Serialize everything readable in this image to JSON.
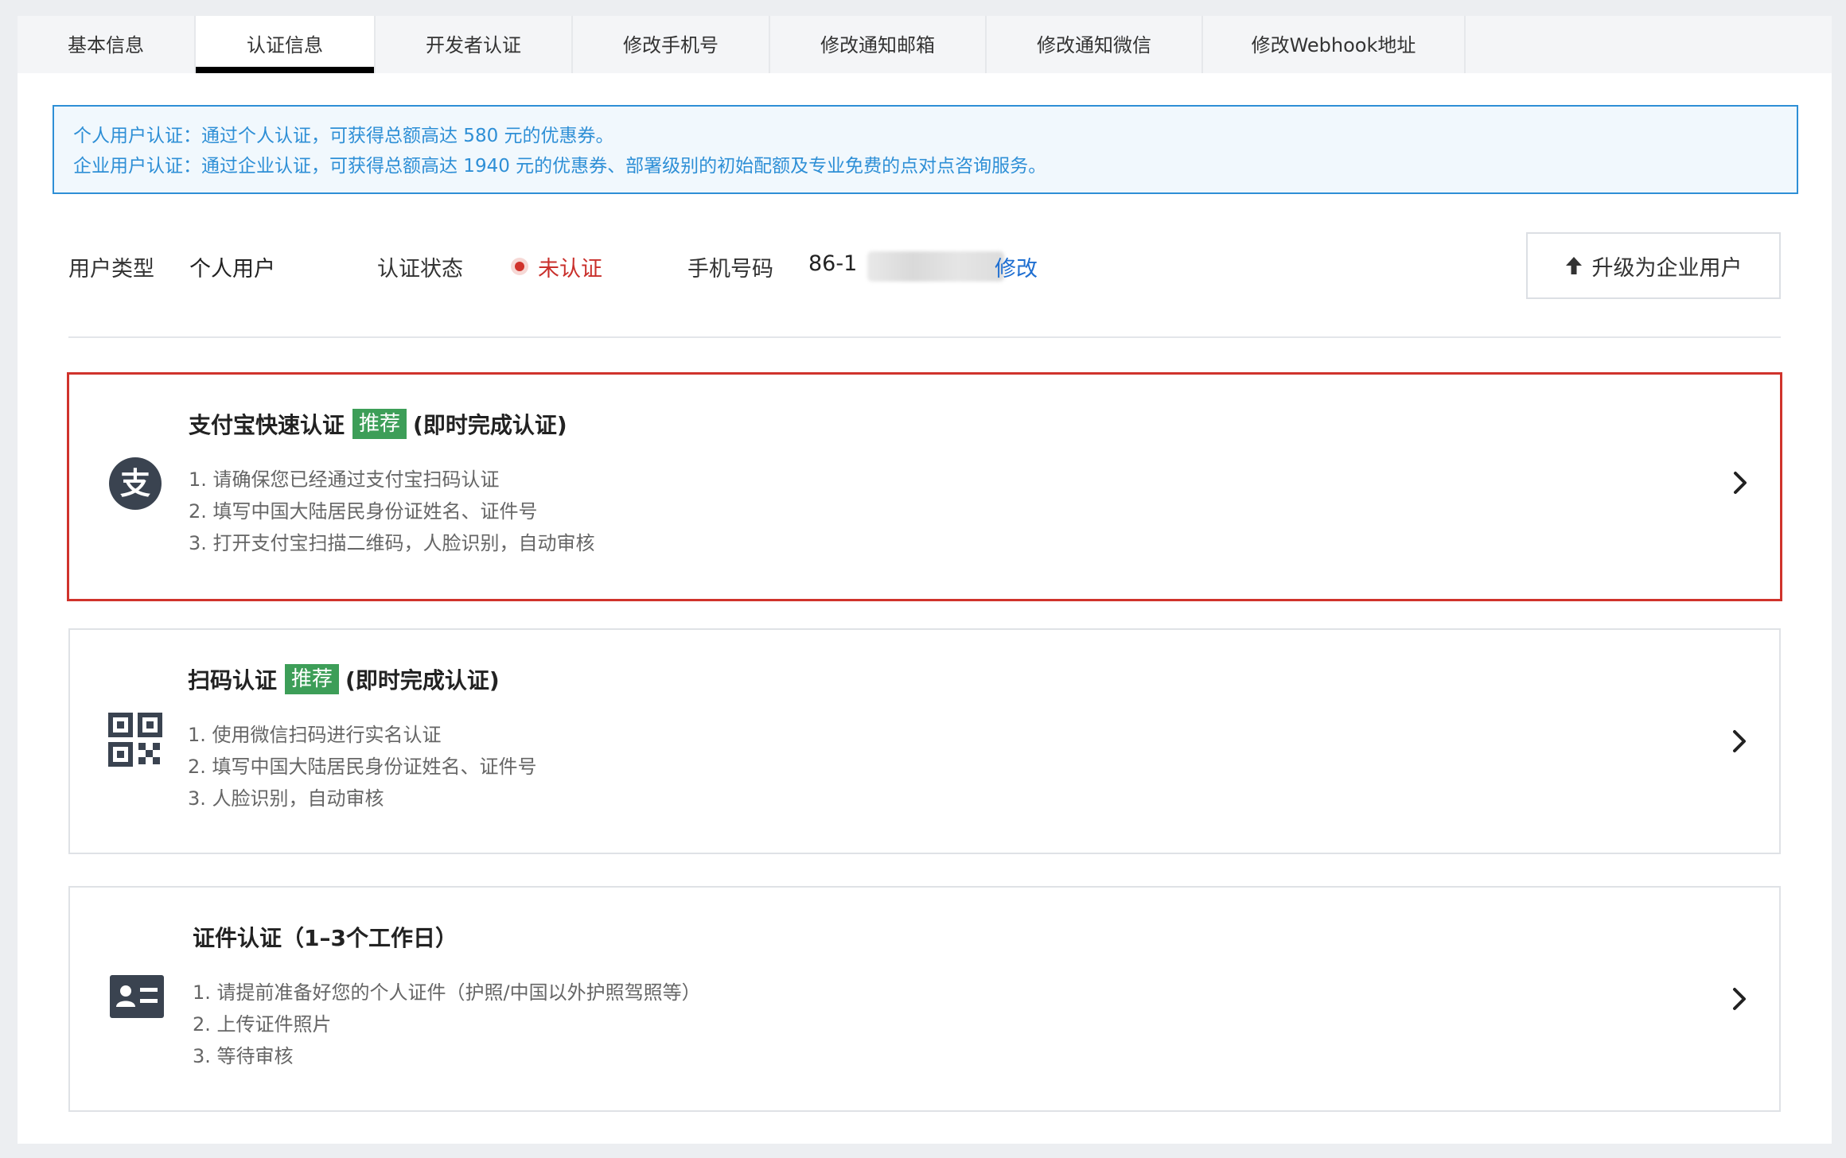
{
  "tabs": [
    {
      "label": "基本信息"
    },
    {
      "label": "认证信息"
    },
    {
      "label": "开发者认证"
    },
    {
      "label": "修改手机号"
    },
    {
      "label": "修改通知邮箱"
    },
    {
      "label": "修改通知微信"
    },
    {
      "label": "修改Webhook地址"
    }
  ],
  "active_tab": "认证信息",
  "banner": {
    "line1": "个人用户认证：通过个人认证，可获得总额高达 580 元的优惠券。",
    "line2": "企业用户认证：通过企业认证，可获得总额高达 1940 元的优惠券、部署级别的初始配额及专业免费的点对点咨询服务。"
  },
  "user_info": {
    "type_label": "用户类型",
    "type_value": "个人用户",
    "status_label": "认证状态",
    "status_value": "未认证",
    "phone_label": "手机号码",
    "phone_value": "86-1",
    "edit_link": "修改",
    "upgrade_button": "升级为企业用户"
  },
  "colors": {
    "accent_blue": "#2e8fd6",
    "link_blue": "#1f6fd1",
    "status_red": "#c9302c",
    "badge_green": "#3d9e58"
  },
  "methods": [
    {
      "title": "支付宝快速认证",
      "badge": "推荐",
      "suffix": "(即时完成认证)",
      "icon": "alipay-icon",
      "steps": [
        "1. 请确保您已经通过支付宝扫码认证",
        "2. 填写中国大陆居民身份证姓名、证件号",
        "3. 打开支付宝扫描二维码，人脸识别，自动审核"
      ]
    },
    {
      "title": "扫码认证",
      "badge": "推荐",
      "suffix": "(即时完成认证)",
      "icon": "qrcode-icon",
      "steps": [
        "1. 使用微信扫码进行实名认证",
        "2. 填写中国大陆居民身份证姓名、证件号",
        "3. 人脸识别，自动审核"
      ]
    },
    {
      "title": "证件认证（1–3个工作日）",
      "badge": "",
      "suffix": "",
      "icon": "id-card-icon",
      "steps": [
        "1. 请提前准备好您的个人证件（护照/中国以外护照驾照等）",
        "2. 上传证件照片",
        "3. 等待审核"
      ]
    }
  ]
}
